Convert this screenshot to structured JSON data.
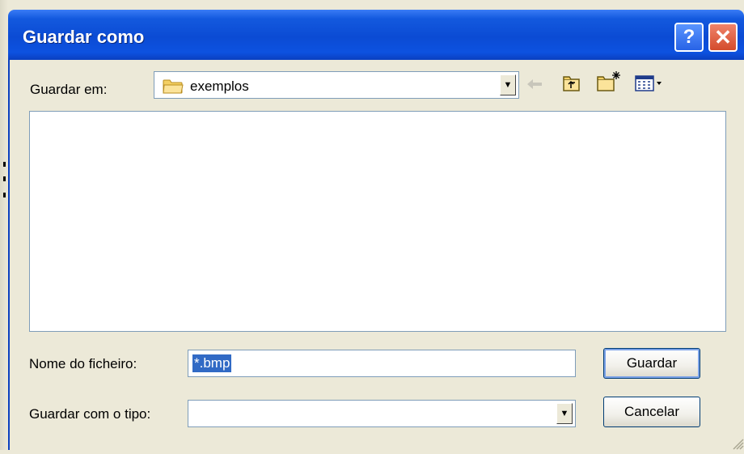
{
  "window": {
    "title": "Guardar como",
    "help_label": "?",
    "close_label": "✕"
  },
  "location": {
    "label": "Guardar em:",
    "folder": "exemplos"
  },
  "filename": {
    "label": "Nome do ficheiro:",
    "value": "*.bmp"
  },
  "filetype": {
    "label": "Guardar com o tipo:",
    "value": ""
  },
  "buttons": {
    "save": "Guardar",
    "cancel": "Cancelar"
  },
  "icons": {
    "back": "back-arrow-icon",
    "up": "up-folder-icon",
    "new_folder": "new-folder-icon",
    "views": "view-menu-icon",
    "folder": "folder-icon"
  },
  "colors": {
    "titlebar": "#0b4bd4",
    "selection": "#316ac5",
    "dialog_bg": "#ece9d8"
  }
}
